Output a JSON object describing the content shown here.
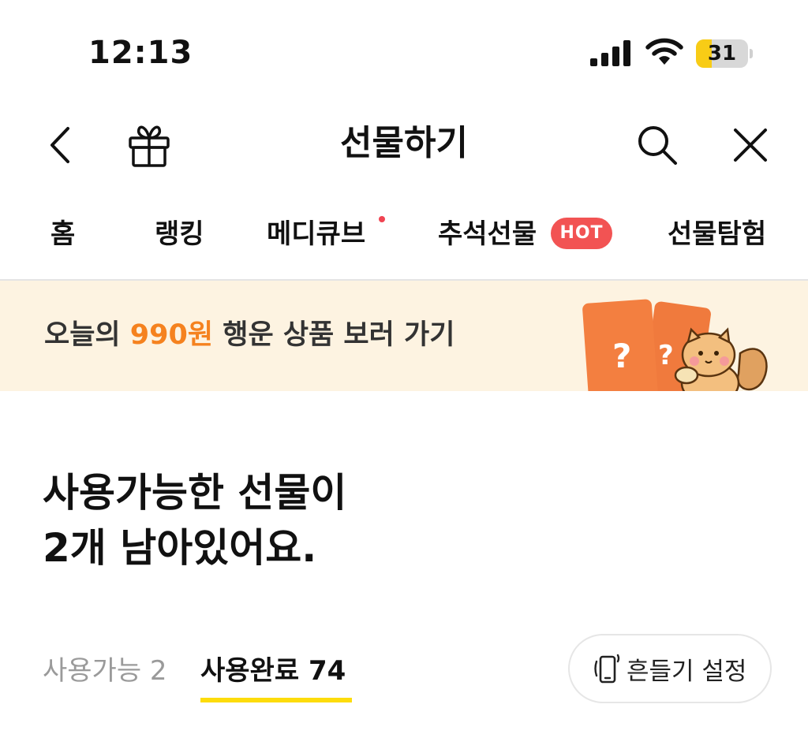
{
  "status_bar": {
    "time": "12:13",
    "battery_level": "31",
    "battery_fraction": 0.31,
    "battery_color": "#f8cc16",
    "icons": [
      "signal-icon",
      "wifi-icon",
      "battery-icon"
    ]
  },
  "header": {
    "title": "선물하기",
    "icons": [
      "back-icon",
      "gift-icon",
      "search-icon",
      "close-icon"
    ]
  },
  "category_tabs": [
    {
      "label": "홈"
    },
    {
      "label": "랭킹"
    },
    {
      "label": "메디큐브",
      "has_dot": true
    },
    {
      "label": "추석선물",
      "badge": "HOT"
    },
    {
      "label": "선물탐험"
    }
  ],
  "banner": {
    "prefix": "오늘의 ",
    "highlight": "990원",
    "suffix": " 행운 상품 보러 가기",
    "highlight_color": "#f5821f",
    "background": "#fdf3e1",
    "card_glyph": "?"
  },
  "main": {
    "heading_line1": "사용가능한 선물이",
    "heading_line2": "2개 남아있어요."
  },
  "gift_tabs": {
    "available": "사용가능 2",
    "used": "사용완료 74",
    "active": "used",
    "underline_color": "#fddc0b"
  },
  "shake_button": {
    "label": "흔들기 설정",
    "icon": "phone-shake-icon"
  }
}
